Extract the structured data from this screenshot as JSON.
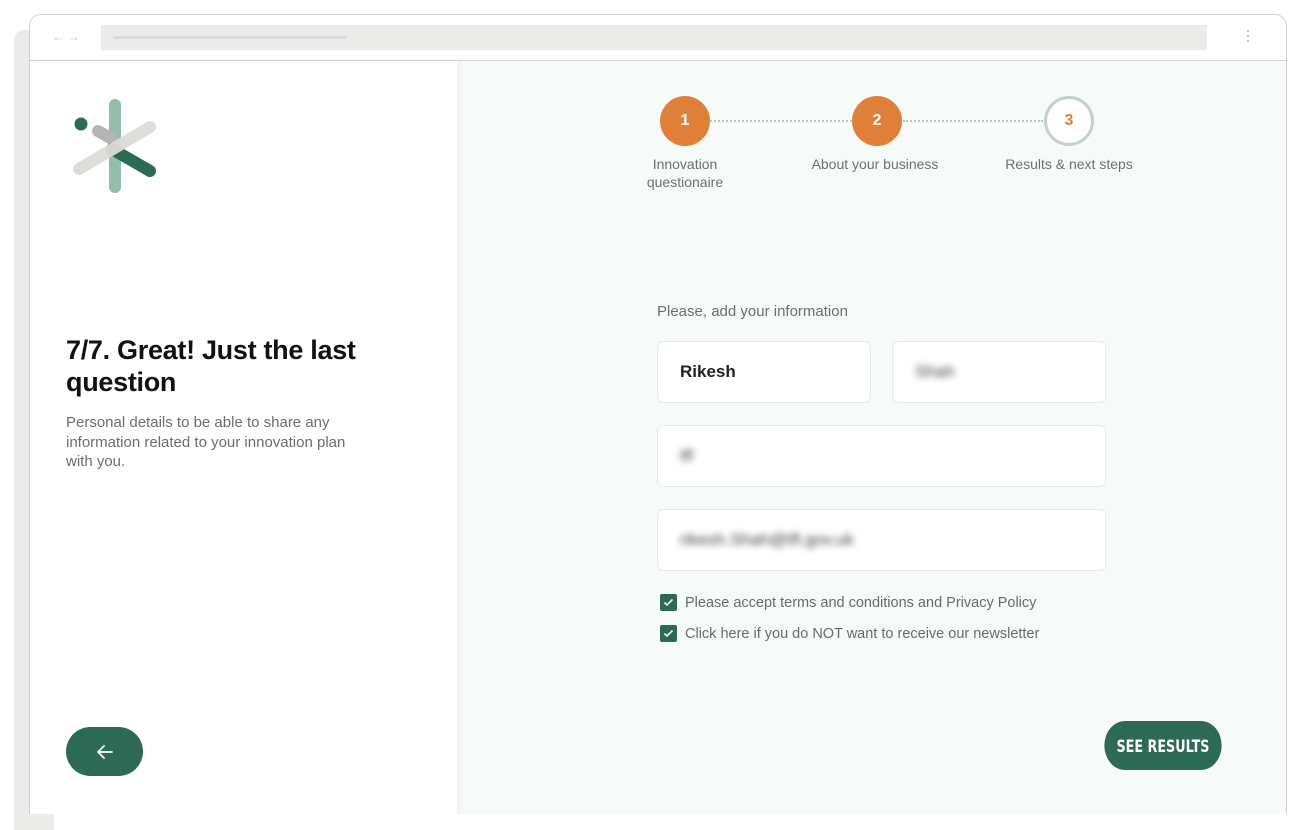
{
  "browser": {
    "nav_back_icon": "arrow-left-icon",
    "nav_forward_icon": "arrow-right-icon",
    "menu_icon": "kebab-menu-icon"
  },
  "left": {
    "headline": "7/7. Great! Just the last question",
    "description": "Personal details to be able to share any information related to your innovation plan with you.",
    "back_button_icon": "arrow-left-icon",
    "colors": {
      "primary": "#2c6a55"
    }
  },
  "stepper": {
    "steps": [
      {
        "number": "1",
        "label": "Innovation questionaire",
        "status": "completed"
      },
      {
        "number": "2",
        "label": "About your business",
        "status": "completed"
      },
      {
        "number": "3",
        "label": "Results & next steps",
        "status": "current"
      }
    ],
    "colors": {
      "completed": "#e07f38",
      "current_border": "#c4d0ca"
    }
  },
  "form": {
    "title": "Please, add your information",
    "fields": {
      "first_name": "Rikesh",
      "last_name": "Shah",
      "company": "tfl",
      "email": "rikesh.Shah@tfl.gov.uk"
    },
    "checkboxes": [
      {
        "label": "Please accept terms and conditions and Privacy Policy",
        "checked": true
      },
      {
        "label": "Click here if you do NOT want to receive our newsletter",
        "checked": true
      }
    ],
    "submit_label": "SEE RESULTS"
  }
}
